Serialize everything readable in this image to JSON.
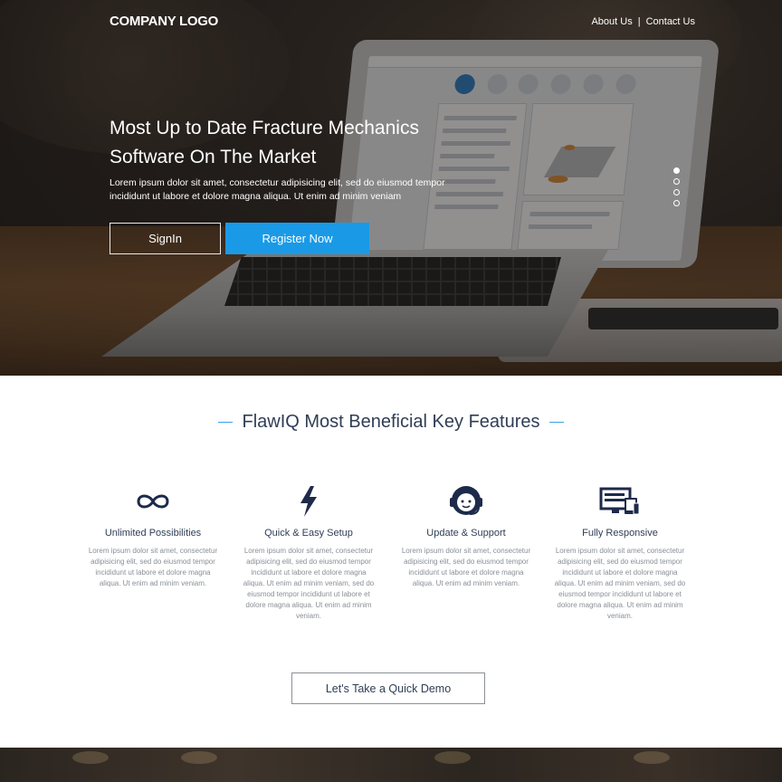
{
  "header": {
    "logo": "COMPANY LOGO",
    "nav": [
      {
        "label": "About Us"
      },
      {
        "label": "Contact Us"
      }
    ],
    "separator": "|"
  },
  "hero": {
    "title": "Most Up to Date Fracture Mechanics Software On The Market",
    "text": "Lorem ipsum dolor sit amet, consectetur adipisicing elit, sed do eiusmod tempor incididunt ut labore et dolore magna aliqua. Ut enim ad minim veniam",
    "signin_label": "SignIn",
    "register_label": "Register Now",
    "slides": 4,
    "active_slide": 1
  },
  "features": {
    "title": "FlawIQ Most Beneficial Key Features",
    "items": [
      {
        "icon": "infinity-icon",
        "title": "Unlimited Possibilities",
        "text": "Lorem ipsum dolor sit amet, consectetur adipisicing elit, sed do eiusmod tempor incididunt ut labore et dolore magna aliqua. Ut enim ad minim veniam."
      },
      {
        "icon": "lightning-icon",
        "title": "Quick & Easy Setup",
        "text": "Lorem ipsum dolor sit amet, consectetur adipisicing elit, sed do eiusmod tempor incididunt ut labore et dolore magna aliqua. Ut enim ad minim veniam, sed do eiusmod tempor incididunt ut labore et dolore magna aliqua. Ut enim ad minim veniam."
      },
      {
        "icon": "headset-support-icon",
        "title": "Update & Support",
        "text": "Lorem ipsum dolor sit amet, consectetur adipisicing elit, sed do eiusmod tempor incididunt ut labore et dolore magna aliqua. Ut enim ad minim veniam."
      },
      {
        "icon": "responsive-devices-icon",
        "title": "Fully Responsive",
        "text": "Lorem ipsum dolor sit amet, consectetur adipisicing elit, sed do eiusmod tempor incididunt ut labore et dolore magna aliqua. Ut enim ad minim veniam, sed do eiusmod tempor incididunt ut labore et dolore magna aliqua. Ut enim ad minim veniam."
      }
    ],
    "demo_label": "Let's Take a Quick Demo"
  },
  "colors": {
    "accent": "#1a9ae6",
    "heading": "#2f3e55",
    "body_text": "#8a8f96",
    "icon": "#1e2a4a"
  }
}
